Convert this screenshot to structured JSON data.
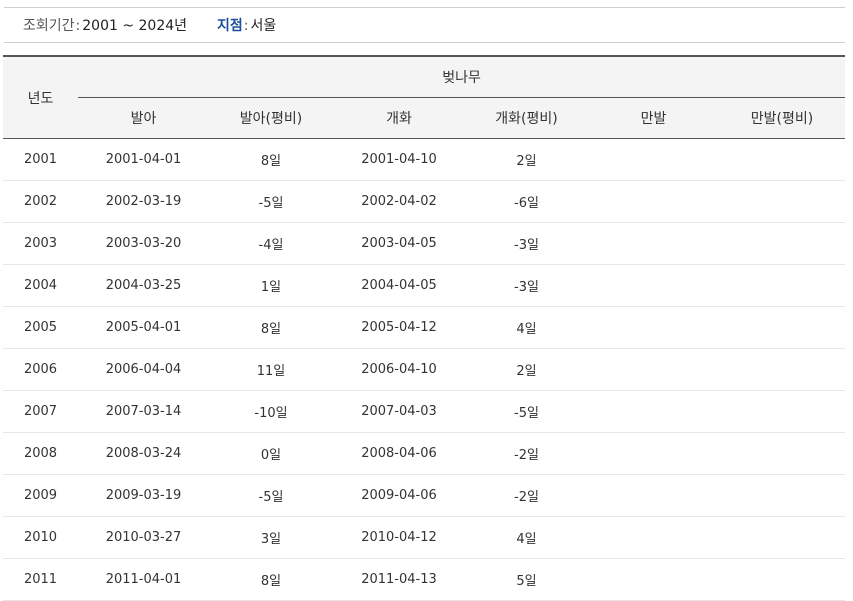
{
  "filter": {
    "period_label": "조회기간",
    "period_sep": ":",
    "period_value": "2001 ~ 2024년",
    "station_label": "지점",
    "station_sep": ":",
    "station_value": "서울"
  },
  "table": {
    "year_header": "년도",
    "group_header": "벚나무",
    "columns": [
      "발아",
      "발아(평비)",
      "개화",
      "개화(평비)",
      "만발",
      "만발(평비)"
    ],
    "rows": [
      {
        "year": "2001",
        "budding": "2001-04-01",
        "budding_diff": "8일",
        "flowering": "2001-04-10",
        "flowering_diff": "2일",
        "full_bloom": "",
        "full_bloom_diff": ""
      },
      {
        "year": "2002",
        "budding": "2002-03-19",
        "budding_diff": "-5일",
        "flowering": "2002-04-02",
        "flowering_diff": "-6일",
        "full_bloom": "",
        "full_bloom_diff": ""
      },
      {
        "year": "2003",
        "budding": "2003-03-20",
        "budding_diff": "-4일",
        "flowering": "2003-04-05",
        "flowering_diff": "-3일",
        "full_bloom": "",
        "full_bloom_diff": ""
      },
      {
        "year": "2004",
        "budding": "2004-03-25",
        "budding_diff": "1일",
        "flowering": "2004-04-05",
        "flowering_diff": "-3일",
        "full_bloom": "",
        "full_bloom_diff": ""
      },
      {
        "year": "2005",
        "budding": "2005-04-01",
        "budding_diff": "8일",
        "flowering": "2005-04-12",
        "flowering_diff": "4일",
        "full_bloom": "",
        "full_bloom_diff": ""
      },
      {
        "year": "2006",
        "budding": "2006-04-04",
        "budding_diff": "11일",
        "flowering": "2006-04-10",
        "flowering_diff": "2일",
        "full_bloom": "",
        "full_bloom_diff": ""
      },
      {
        "year": "2007",
        "budding": "2007-03-14",
        "budding_diff": "-10일",
        "flowering": "2007-04-03",
        "flowering_diff": "-5일",
        "full_bloom": "",
        "full_bloom_diff": ""
      },
      {
        "year": "2008",
        "budding": "2008-03-24",
        "budding_diff": "0일",
        "flowering": "2008-04-06",
        "flowering_diff": "-2일",
        "full_bloom": "",
        "full_bloom_diff": ""
      },
      {
        "year": "2009",
        "budding": "2009-03-19",
        "budding_diff": "-5일",
        "flowering": "2009-04-06",
        "flowering_diff": "-2일",
        "full_bloom": "",
        "full_bloom_diff": ""
      },
      {
        "year": "2010",
        "budding": "2010-03-27",
        "budding_diff": "3일",
        "flowering": "2010-04-12",
        "flowering_diff": "4일",
        "full_bloom": "",
        "full_bloom_diff": ""
      },
      {
        "year": "2011",
        "budding": "2011-04-01",
        "budding_diff": "8일",
        "flowering": "2011-04-13",
        "flowering_diff": "5일",
        "full_bloom": "",
        "full_bloom_diff": ""
      }
    ]
  }
}
